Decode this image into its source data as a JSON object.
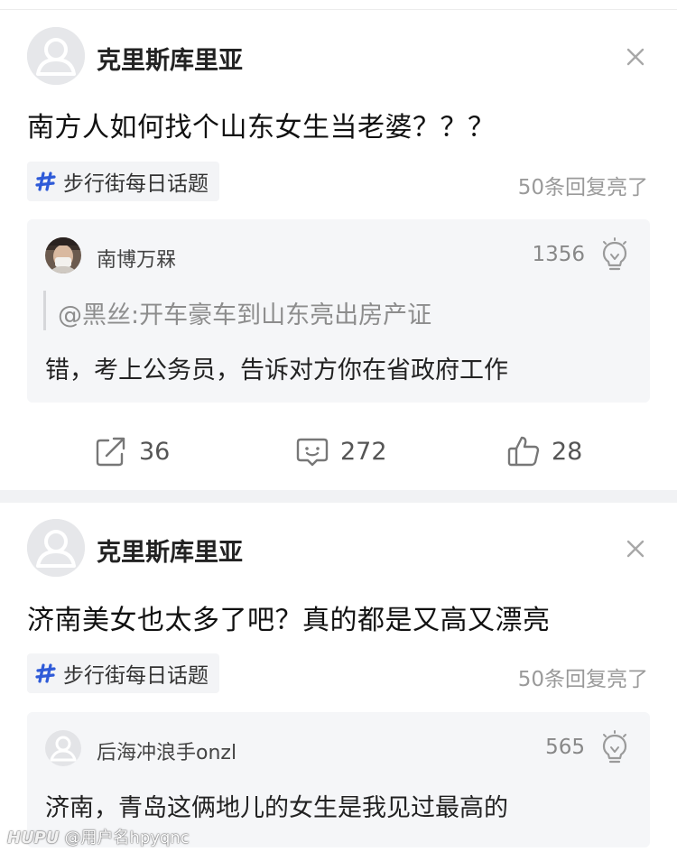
{
  "posts": [
    {
      "author": "克里斯库里亚",
      "title": "南方人如何找个山东女生当老婆？？？",
      "topic": "步行街每日话题",
      "reply_status": "50条回复亮了",
      "highlight": {
        "user": "南博万槑",
        "lights": "1356",
        "quoted": "@黑丝:开车豪车到山东亮出房产证",
        "text": "错，考上公务员，告诉对方你在省政府工作"
      },
      "actions": {
        "share": "36",
        "comment": "272",
        "like": "28"
      }
    },
    {
      "author": "克里斯库里亚",
      "title": "济南美女也太多了吧？真的都是又高又漂亮",
      "topic": "步行街每日话题",
      "reply_status": "50条回复亮了",
      "highlight": {
        "user": "后海冲浪手onzl",
        "lights": "565",
        "text": "济南，青岛这俩地儿的女生是我见过最高的"
      }
    }
  ],
  "watermark": {
    "brand": "HUPU",
    "text": "@用户名hpyqnc"
  },
  "colors": {
    "accent": "#2f5bd8",
    "background": "#ffffff",
    "separator": "#f1f2f4",
    "quote_bg": "#f5f6f8"
  },
  "icons": [
    "default-avatar-icon",
    "close-icon",
    "topic-hash-icon",
    "lightbulb-icon",
    "share-icon",
    "comment-icon",
    "like-icon"
  ]
}
